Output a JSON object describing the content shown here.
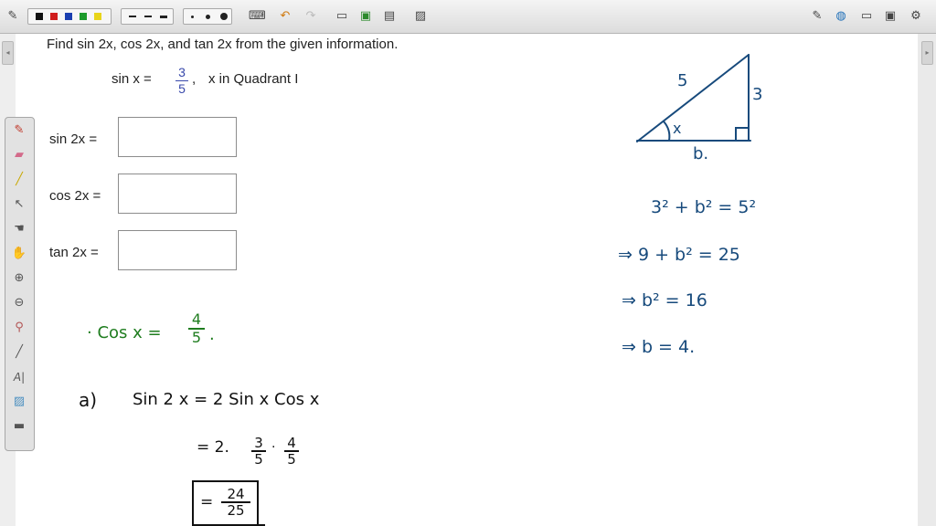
{
  "question": {
    "prompt": "Find sin 2x, cos 2x, and tan 2x from the given information.",
    "given_prefix": "sin x =",
    "given_num": "3",
    "given_den": "5",
    "given_suffix": "x in Quadrant I"
  },
  "answer_rows": [
    {
      "label": "sin 2x =",
      "value": ""
    },
    {
      "label": "cos 2x =",
      "value": ""
    },
    {
      "label": "tan 2x =",
      "value": ""
    }
  ],
  "annotations": {
    "triangle": {
      "hyp": "5",
      "opp": "3",
      "adj": "b.",
      "angle": "x"
    },
    "pythag": [
      "3² + b² = 5²",
      "⇒  9 + b² = 25",
      "⇒  b² = 16",
      "⇒  b = 4."
    ],
    "cos_line": "· Cos x = ",
    "cos_num": "4",
    "cos_den": "5",
    "part_label": "a)",
    "sin2x_line": "Sin 2 x =   2 Sin x Cos x",
    "step_prefix": "=  2.",
    "step_f1_num": "3",
    "step_f1_den": "5",
    "step_f2_num": "4",
    "step_f2_den": "5",
    "result_prefix": "=",
    "result_num": "24",
    "result_den": "25"
  },
  "colors": {
    "ink_blue": "#174a7c",
    "ink_green": "#1f7d1f",
    "ink_black": "#111111",
    "fraction_blue": "#3949ab"
  },
  "toolbar_icons": [
    "pen-icon",
    "color-palette",
    "line-styles",
    "point-sizes",
    "keyboard-icon",
    "undo-icon",
    "redo-icon",
    "new-page-icon",
    "save-icon",
    "document-icon",
    "image-icon",
    "edit-icon",
    "globe-icon",
    "folder-icon",
    "monitor-icon",
    "settings-icon"
  ],
  "side_tools": [
    "pen-tool-icon",
    "eraser-tool-icon",
    "highlighter-tool-icon",
    "pointer-tool-icon",
    "hand-tool-icon",
    "grab-tool-icon",
    "zoom-in-icon",
    "zoom-out-icon",
    "dropper-icon",
    "line-tool-icon",
    "text-tool-icon",
    "image-tool-icon",
    "keyboard-tool-icon"
  ]
}
